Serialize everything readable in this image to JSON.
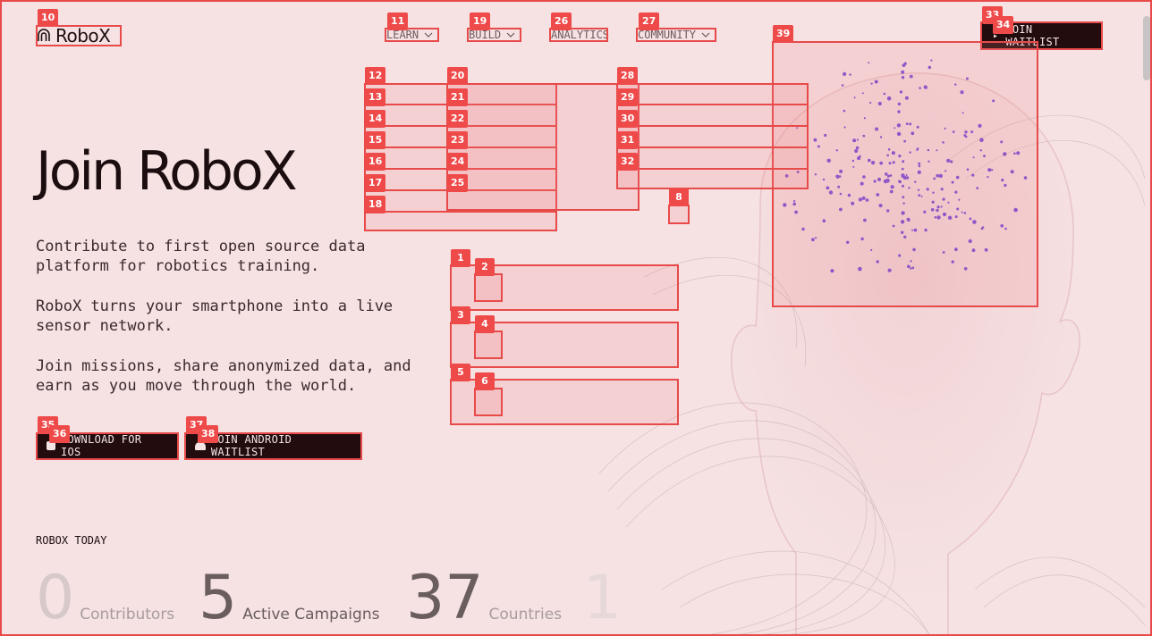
{
  "brand": {
    "name": "RoboX",
    "logo_icon": "fingerprint-icon"
  },
  "nav": {
    "items": [
      {
        "label": "LEARN",
        "has_dropdown": true
      },
      {
        "label": "BUILD",
        "has_dropdown": true
      },
      {
        "label": "ANALYTICS",
        "has_dropdown": false
      },
      {
        "label": "COMMUNITY",
        "has_dropdown": true
      }
    ],
    "cta_label": "JOIN WAITLIST"
  },
  "hero": {
    "title": "Join RoboX",
    "paragraphs": [
      "Contribute to first open source data platform for robotics training.",
      "RoboX turns your smartphone into a live sensor network.",
      "Join missions, share anonymized data, and earn as you move through the world."
    ],
    "ios_button": "DOWNLOAD FOR IOS",
    "android_button": "JOIN ANDROID WAITLIST"
  },
  "stats": {
    "section_label": "ROBOX TODAY",
    "items": [
      {
        "value": "0",
        "label": "Contributors"
      },
      {
        "value": "5",
        "label": "Active Campaigns"
      },
      {
        "value": "37",
        "label": "Countries"
      },
      {
        "value": "1",
        "label": ""
      }
    ]
  },
  "overlay_tags": [
    "1",
    "2",
    "3",
    "4",
    "5",
    "6",
    "8",
    "10",
    "11",
    "12",
    "13",
    "14",
    "15",
    "16",
    "17",
    "18",
    "19",
    "20",
    "21",
    "22",
    "23",
    "24",
    "25",
    "26",
    "27",
    "28",
    "29",
    "30",
    "31",
    "32",
    "33",
    "34",
    "35",
    "36",
    "37",
    "38",
    "39"
  ],
  "colors": {
    "background": "#f6e2e3",
    "dark": "#230c0e",
    "accent": "#ef4a4a",
    "dots": "#7b4fd6"
  }
}
